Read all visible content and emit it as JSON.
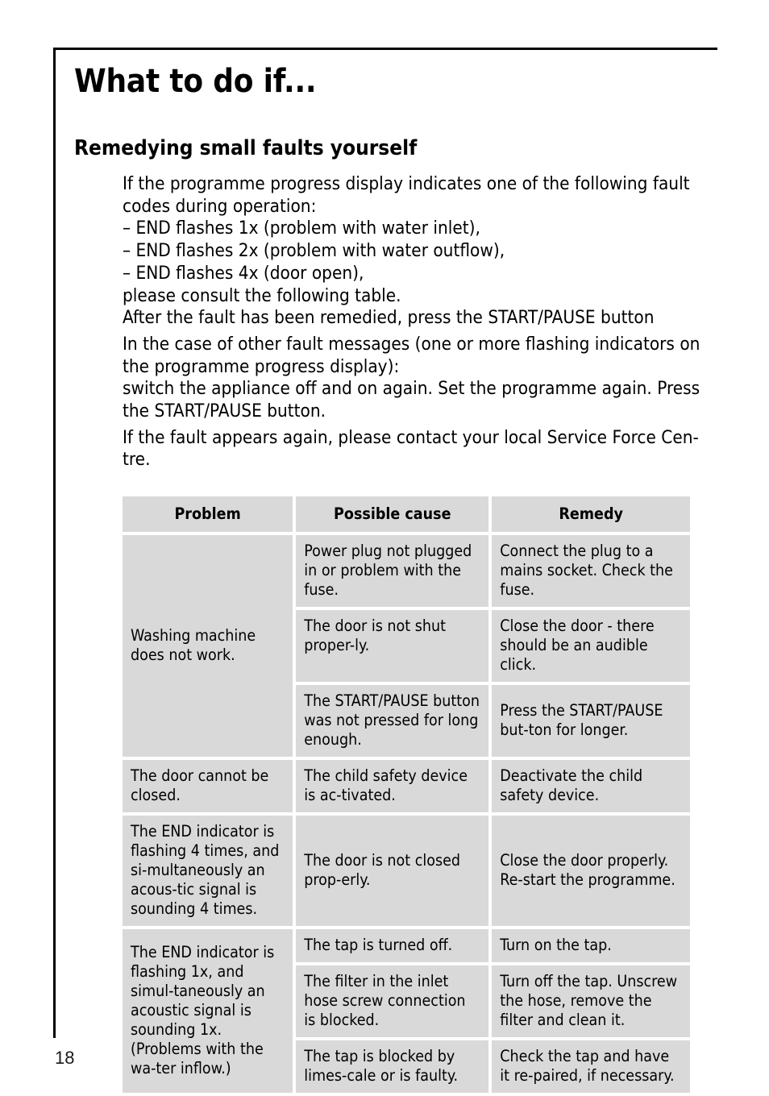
{
  "page": {
    "number": "18",
    "title": "What to do if...",
    "subtitle": "Remedying small faults yourself"
  },
  "body": {
    "paragraphs": [
      {
        "id": "fault-codes-intro",
        "lines": [
          "If the programme progress display indicates one of the following fault",
          "codes during operation:",
          "– END flashes 1x (problem with water inlet),",
          "– END flashes 2x (problem with water outflow),",
          "– END flashes 4x (door open),",
          "please consult the following table.",
          "After the fault has been remedied, press the START/PAUSE button"
        ]
      },
      {
        "id": "other-fault-messages",
        "lines": [
          "In the case of other fault messages (one or more flashing indicators on",
          "the programme progress display):",
          "switch the appliance off and on again. Set the programme again. Press",
          "the START/PAUSE button."
        ]
      },
      {
        "id": "service-force-centre",
        "lines": [
          "If the fault appears again, please contact your local Service Force Cen-",
          "tre."
        ]
      }
    ]
  },
  "table": {
    "headers": [
      "Problem",
      "Possible cause",
      "Remedy"
    ],
    "groups": [
      {
        "problem": "Washing machine does not work.",
        "rows": [
          {
            "cause": "Power plug not plugged in or problem with the fuse.",
            "remedy": "Connect the plug to a mains socket. Check the fuse."
          },
          {
            "cause": "The door is not shut proper-ly.",
            "remedy": "Close the door - there should be an audible click."
          },
          {
            "cause": "The START/PAUSE button was not pressed for long enough.",
            "remedy": "Press the START/PAUSE but-ton for longer."
          }
        ]
      },
      {
        "problem": "The door cannot be closed.",
        "rows": [
          {
            "cause": "The child safety device is ac-tivated.",
            "remedy": "Deactivate the child safety device."
          }
        ]
      },
      {
        "problem": "The END indicator is flashing 4 times, and si-multaneously an acous-tic signal is sounding 4 times.",
        "rows": [
          {
            "cause": "The door is not closed prop-erly.",
            "remedy": "Close the door properly. Re-start the programme."
          }
        ]
      },
      {
        "problem": "The END indicator is flashing 1x, and simul-taneously an acoustic signal is sounding 1x. (Problems with the wa-ter inflow.)",
        "rows": [
          {
            "cause": "The tap is turned off.",
            "remedy": "Turn on the tap."
          },
          {
            "cause": "The filter in the inlet hose screw connection is blocked.",
            "remedy": "Turn off the tap. Unscrew the hose, remove the filter and clean it."
          },
          {
            "cause": "The tap is blocked by limes-cale or is faulty.",
            "remedy": "Check the tap and have it re-paired, if necessary."
          }
        ]
      }
    ]
  },
  "colors": {
    "cell_background": "#d9d9d9",
    "text": "#000000",
    "rule": "#000000"
  }
}
